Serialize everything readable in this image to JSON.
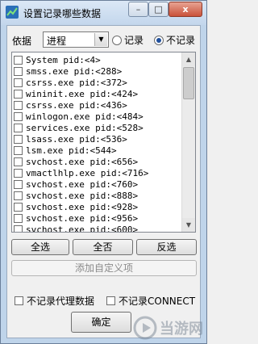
{
  "window": {
    "title": "设置记录哪些数据",
    "min_label": "–",
    "max_label": "□",
    "close_label": "x"
  },
  "filter": {
    "label": "依据",
    "select_value": "进程",
    "radio_record": "记录",
    "radio_norecord": "不记录",
    "selected": "不记录"
  },
  "process_list": [
    "System  pid:<4>",
    "smss.exe  pid:<288>",
    "csrss.exe  pid:<372>",
    "wininit.exe  pid:<424>",
    "csrss.exe  pid:<436>",
    "winlogon.exe  pid:<484>",
    "services.exe  pid:<528>",
    "lsass.exe  pid:<536>",
    "lsm.exe  pid:<544>",
    "svchost.exe  pid:<656>",
    "vmactlhlp.exe  pid:<716>",
    "svchost.exe  pid:<760>",
    "svchost.exe  pid:<888>",
    "svchost.exe  pid:<928>",
    "svchost.exe  pid:<956>",
    "svchost.exe  pid:<600>"
  ],
  "buttons": {
    "select_all": "全选",
    "select_none": "全否",
    "invert": "反选",
    "add_custom": "添加自定义项",
    "ok": "确定"
  },
  "options": {
    "no_proxy": "不记录代理数据",
    "no_connect": "不记录CONNECT"
  },
  "watermark": {
    "text": "当游网"
  }
}
